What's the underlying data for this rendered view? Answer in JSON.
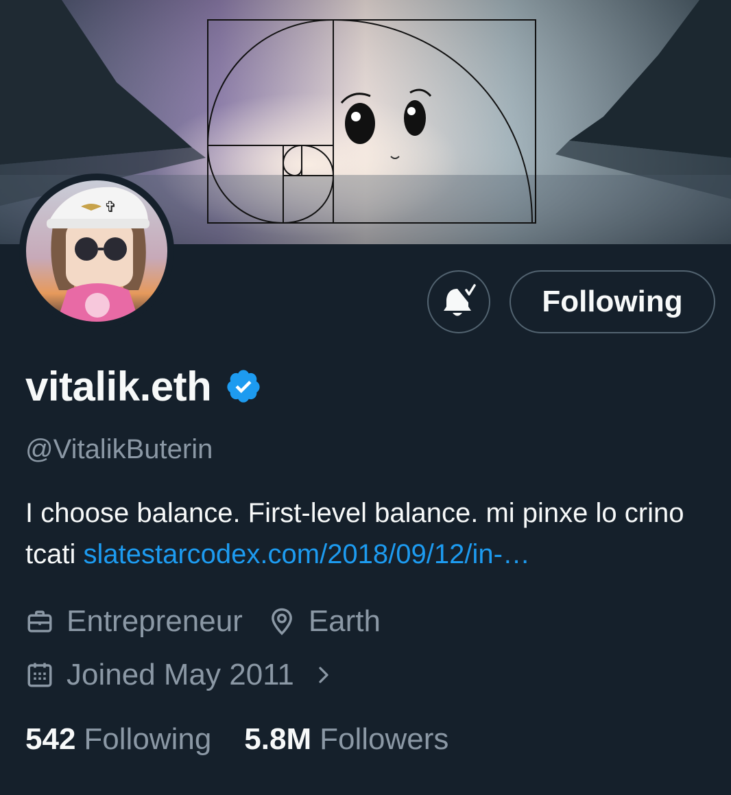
{
  "profile": {
    "display_name": "vitalik.eth",
    "handle": "@VitalikButerin",
    "bio_text": "I choose balance. First-level balance.  mi pinxe lo crino tcati ",
    "bio_link": "slatestarcodex.com/2018/09/12/in-…",
    "occupation": "Entrepreneur",
    "location": "Earth",
    "joined": "Joined May 2011"
  },
  "actions": {
    "follow_label": "Following"
  },
  "stats": {
    "following_count": "542",
    "following_label": "Following",
    "followers_count": "5.8M",
    "followers_label": "Followers"
  },
  "icons": {
    "verified": "verified-badge-icon",
    "notifications": "bell-check-icon",
    "occupation": "briefcase-icon",
    "location": "map-pin-icon",
    "joined": "calendar-icon",
    "chevron": "chevron-right-icon"
  },
  "colors": {
    "background": "#15202b",
    "text": "#f7f9f9",
    "secondary": "#8b98a5",
    "link": "#1d9bf0",
    "border": "#536471"
  }
}
